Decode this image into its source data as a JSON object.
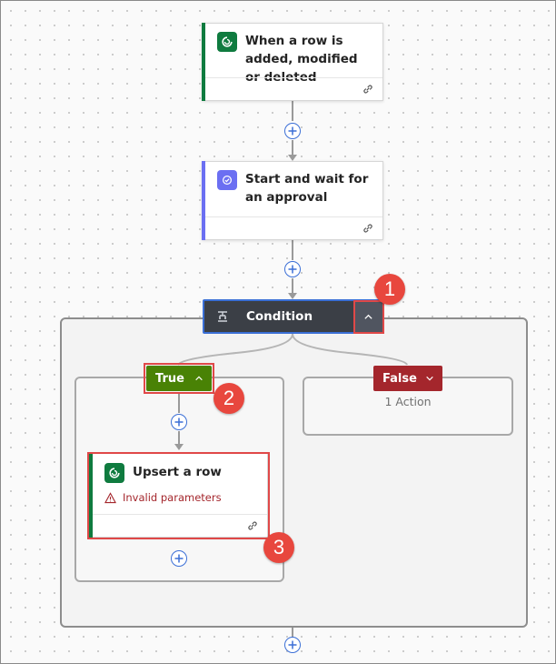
{
  "flow": {
    "trigger": {
      "title": "When a row is added, modified or deleted",
      "icon": "dataverse-icon",
      "accent": "#0f7b3f"
    },
    "approval": {
      "title": "Start and wait for an approval",
      "icon": "approvals-icon",
      "accent": "#6b6ff2"
    },
    "condition": {
      "title": "Condition",
      "icon": "condition-icon",
      "toggle": "chevron-up-icon"
    },
    "true_branch": {
      "label": "True",
      "color": "#498205",
      "action": {
        "title": "Upsert a row",
        "error": "Invalid parameters",
        "icon": "dataverse-icon"
      }
    },
    "false_branch": {
      "label": "False",
      "color": "#a4262c",
      "summary": "1 Action"
    }
  },
  "callouts": [
    "1",
    "2",
    "3"
  ],
  "colors": {
    "add_button": "#3b6fd6",
    "callout": "#e8473e",
    "connector": "#9a9a9a",
    "error": "#a4262c"
  }
}
